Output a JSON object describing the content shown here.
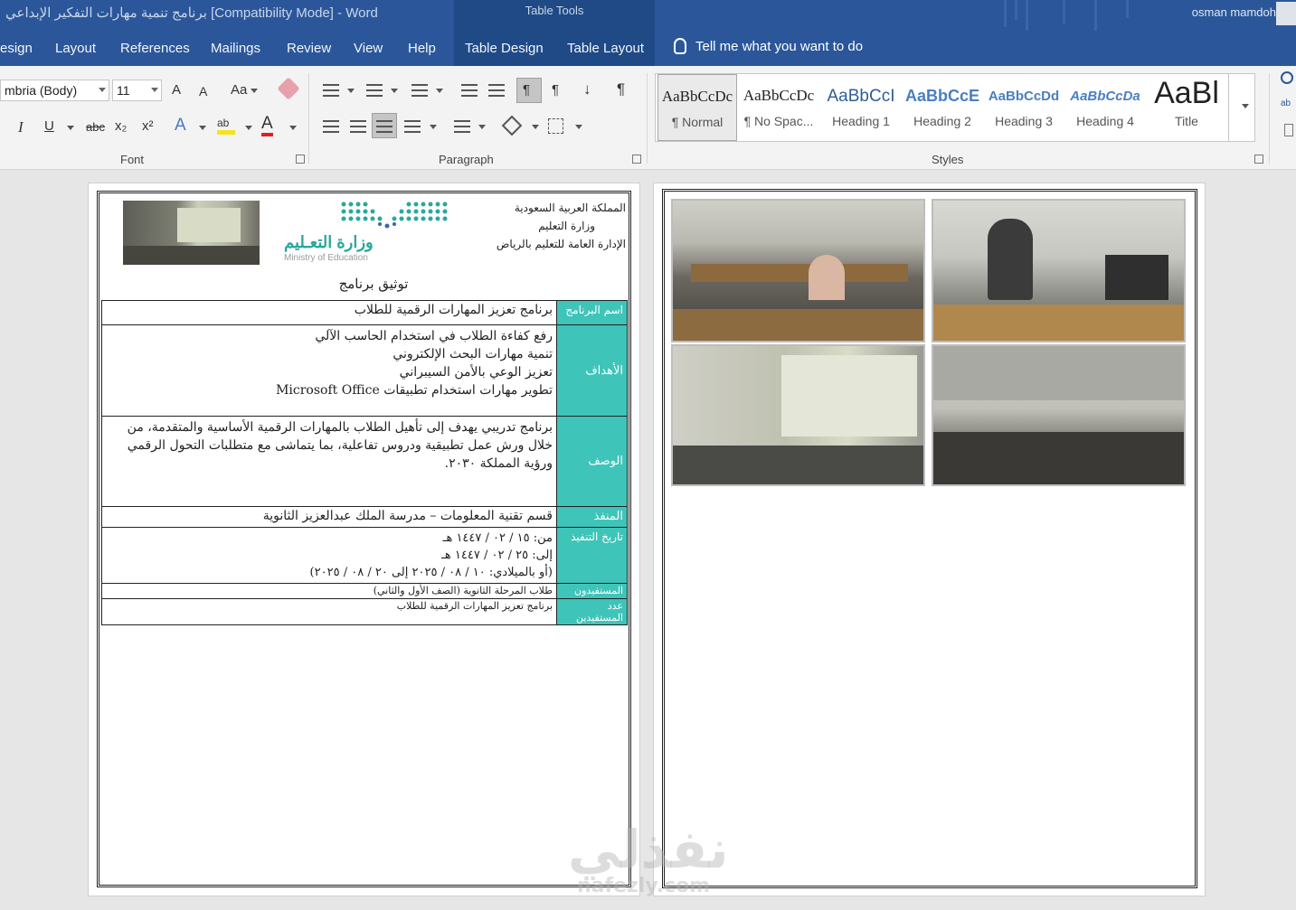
{
  "window": {
    "title": "برنامج تنمية مهارات التفكير الإبداعي [Compatibility Mode]  -  Word",
    "context_tab_group": "Table Tools",
    "user_name": "osman mamdoh"
  },
  "tabs": [
    "esign",
    "Layout",
    "References",
    "Mailings",
    "Review",
    "View",
    "Help",
    "Table Design",
    "Table Layout"
  ],
  "tell_me": "Tell me what you want to do",
  "ribbon": {
    "font": {
      "label": "Font",
      "font_name": "mbria (Body)",
      "font_size": "11",
      "grow": "A",
      "shrink": "A",
      "change_case": "Aa",
      "italic": "I",
      "underline": "U",
      "strikethrough": "abc",
      "subscript": "x₂",
      "superscript": "x²",
      "font_color": "A"
    },
    "paragraph": {
      "label": "Paragraph"
    },
    "styles": {
      "label": "Styles",
      "items": [
        {
          "sample": "AaBbCcDc",
          "name": "¶ Normal"
        },
        {
          "sample": "AaBbCcDc",
          "name": "¶ No Spac..."
        },
        {
          "sample": "AaBbCcI",
          "name": "Heading 1"
        },
        {
          "sample": "AaBbCcE",
          "name": "Heading 2"
        },
        {
          "sample": "AaBbCcDd",
          "name": "Heading 3"
        },
        {
          "sample": "AaBbCcDa",
          "name": "Heading 4"
        },
        {
          "sample": "AaBl",
          "name": "Title"
        }
      ]
    }
  },
  "doc": {
    "header": {
      "line1": "المملكة العربية السعودية",
      "line2": "وزارة التعليم",
      "line3": "الإدارة العامة للتعليم بالرياض",
      "ministry_ar": "وزارة التعـليم",
      "ministry_en": "Ministry of Education"
    },
    "title": "توثيق برنامج",
    "rows": [
      {
        "label": "اسم البرنامج",
        "value": "برنامج تعزيز المهارات الرقمية للطلاب"
      },
      {
        "label": "الأهداف",
        "lines": [
          "رفع كفاءة الطلاب في استخدام الحاسب الآلي",
          "تنمية مهارات البحث الإلكتروني",
          "تعزيز الوعي بالأمن السيبراني",
          "تطوير مهارات استخدام تطبيقات Microsoft Office"
        ]
      },
      {
        "label": "الوصف",
        "value": "برنامج تدريبي يهدف إلى تأهيل الطلاب بالمهارات الرقمية الأساسية والمتقدمة، من خلال ورش عمل تطبيقية ودروس تفاعلية، بما يتماشى مع متطلبات التحول الرقمي ورؤية المملكة ٢٠٣٠."
      },
      {
        "label": "المنفذ",
        "value": "قسم تقنية المعلومات – مدرسة الملك عبدالعزيز الثانوية"
      },
      {
        "label": "تاريخ التنفيذ",
        "lines": [
          "من: ١٥ / ٠٢ / ١٤٤٧ هـ",
          "إلى: ٢٥ / ٠٢ / ١٤٤٧ هـ",
          "(أو بالميلادي: ١٠ / ٠٨ / ٢٠٢٥ إلى ٢٠ / ٠٨ / ٢٠٢٥)"
        ]
      },
      {
        "label": "المستفيدون",
        "value": "طلاب المرحلة الثانوية (الصف الأول والثاني)"
      },
      {
        "label": "عدد المستفيدين",
        "value": "برنامج تعزيز المهارات الرقمية للطلاب"
      }
    ]
  },
  "watermark": {
    "ar": "نفذلي",
    "en": "nafezly.com"
  },
  "colors": {
    "word_blue": "#2b579a",
    "label_teal": "#3fc4b9"
  }
}
